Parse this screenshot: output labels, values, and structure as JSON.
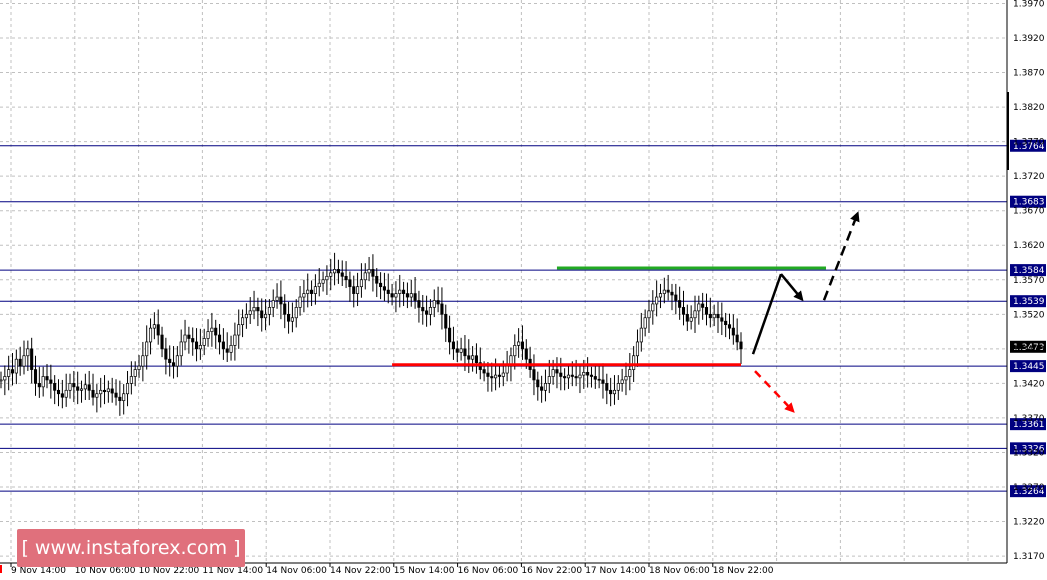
{
  "chart_data": {
    "type": "candlestick",
    "y_range": [
      1.316,
      1.3975
    ],
    "y_ticks": [
      "1.3970",
      "1.3920",
      "1.3870",
      "1.3820",
      "1.3770",
      "1.3720",
      "1.3670",
      "1.3620",
      "1.3570",
      "1.3520",
      "1.3470",
      "1.3420",
      "1.3370",
      "1.3320",
      "1.3270",
      "1.3220",
      "1.3170"
    ],
    "x_ticks": [
      "9 Nov 14:00",
      "10 Nov 06:00",
      "10 Nov 22:00",
      "11 Nov 14:00",
      "14 Nov 06:00",
      "14 Nov 22:00",
      "15 Nov 14:00",
      "16 Nov 06:00",
      "16 Nov 22:00",
      "17 Nov 14:00",
      "18 Nov 06:00",
      "18 Nov 22:00"
    ],
    "levels": [
      {
        "label": "1.3764",
        "value": 1.3764
      },
      {
        "label": "1.3683",
        "value": 1.3683
      },
      {
        "label": "1.3584",
        "value": 1.3584
      },
      {
        "label": "1.3539",
        "value": 1.3539
      },
      {
        "label": "1.3445",
        "value": 1.3445
      },
      {
        "label": "1.3361",
        "value": 1.3361
      },
      {
        "label": "1.3326",
        "value": 1.3326
      },
      {
        "label": "1.3264",
        "value": 1.3264
      }
    ],
    "current_price": {
      "label": "1.3473",
      "value": 1.3473
    },
    "green_line": {
      "value": 1.3587,
      "from_bar": 145,
      "to_bar": 285
    },
    "red_line": {
      "value": 1.3447,
      "from_bar": 102,
      "to_bar": 255
    },
    "series_close": [
      1.3425,
      1.343,
      1.344,
      1.3435,
      1.3455,
      1.3445,
      1.346,
      1.347,
      1.344,
      1.342,
      1.3415,
      1.343,
      1.3425,
      1.342,
      1.341,
      1.3405,
      1.34,
      1.341,
      1.342,
      1.3415,
      1.341,
      1.3412,
      1.3418,
      1.341,
      1.34,
      1.3405,
      1.341,
      1.3408,
      1.3412,
      1.3406,
      1.34,
      1.3395,
      1.3405,
      1.342,
      1.343,
      1.344,
      1.3445,
      1.346,
      1.348,
      1.35,
      1.3505,
      1.349,
      1.347,
      1.3455,
      1.345,
      1.3445,
      1.346,
      1.348,
      1.349,
      1.3485,
      1.348,
      1.347,
      1.3475,
      1.3485,
      1.3495,
      1.35,
      1.349,
      1.348,
      1.347,
      1.3465,
      1.3475,
      1.349,
      1.3505,
      1.3515,
      1.352,
      1.3525,
      1.353,
      1.3525,
      1.3515,
      1.352,
      1.353,
      1.354,
      1.3545,
      1.3535,
      1.352,
      1.351,
      1.3515,
      1.353,
      1.3545,
      1.355,
      1.3555,
      1.355,
      1.356,
      1.3565,
      1.357,
      1.3575,
      1.358,
      1.3585,
      1.358,
      1.3575,
      1.357,
      1.356,
      1.355,
      1.356,
      1.357,
      1.358,
      1.3585,
      1.3575,
      1.3565,
      1.356,
      1.3555,
      1.355,
      1.3545,
      1.355,
      1.3555,
      1.355,
      1.3545,
      1.355,
      1.354,
      1.353,
      1.3525,
      1.352,
      1.353,
      1.354,
      1.3535,
      1.352,
      1.35,
      1.348,
      1.347,
      1.3465,
      1.347,
      1.346,
      1.3455,
      1.346,
      1.345,
      1.344,
      1.3435,
      1.343,
      1.3428,
      1.3432,
      1.343,
      1.3435,
      1.3445,
      1.346,
      1.3475,
      1.348,
      1.347,
      1.3455,
      1.344,
      1.3425,
      1.3415,
      1.341,
      1.342,
      1.343,
      1.344,
      1.3435,
      1.343,
      1.3428,
      1.3432,
      1.343,
      1.3428,
      1.3432,
      1.3436,
      1.3432,
      1.343,
      1.3426,
      1.3425,
      1.342,
      1.341,
      1.3405,
      1.341,
      1.342,
      1.3425,
      1.343,
      1.344,
      1.346,
      1.348,
      1.35,
      1.3515,
      1.3525,
      1.3535,
      1.3545,
      1.355,
      1.3555,
      1.3552,
      1.3548,
      1.354,
      1.353,
      1.352,
      1.351,
      1.3515,
      1.3525,
      1.3535,
      1.353,
      1.352,
      1.3515,
      1.352,
      1.3515,
      1.351,
      1.3505,
      1.35,
      1.349,
      1.348,
      1.347
    ],
    "projection_arrows": [
      {
        "color": "#000000",
        "style": "solid",
        "desc": "up"
      },
      {
        "color": "#000000",
        "style": "solid",
        "desc": "down-right"
      },
      {
        "color": "#000000",
        "style": "dashed",
        "desc": "up"
      },
      {
        "color": "#ff0000",
        "style": "dashed",
        "desc": "down"
      }
    ],
    "colors": {
      "level_line": "#000080",
      "level_label_bg": "#000080",
      "green_line": "#22aa22",
      "red_line": "#ff0000",
      "grid": "#c0c0c0"
    }
  },
  "watermark": {
    "text": "[ www.instaforex.com ]"
  }
}
